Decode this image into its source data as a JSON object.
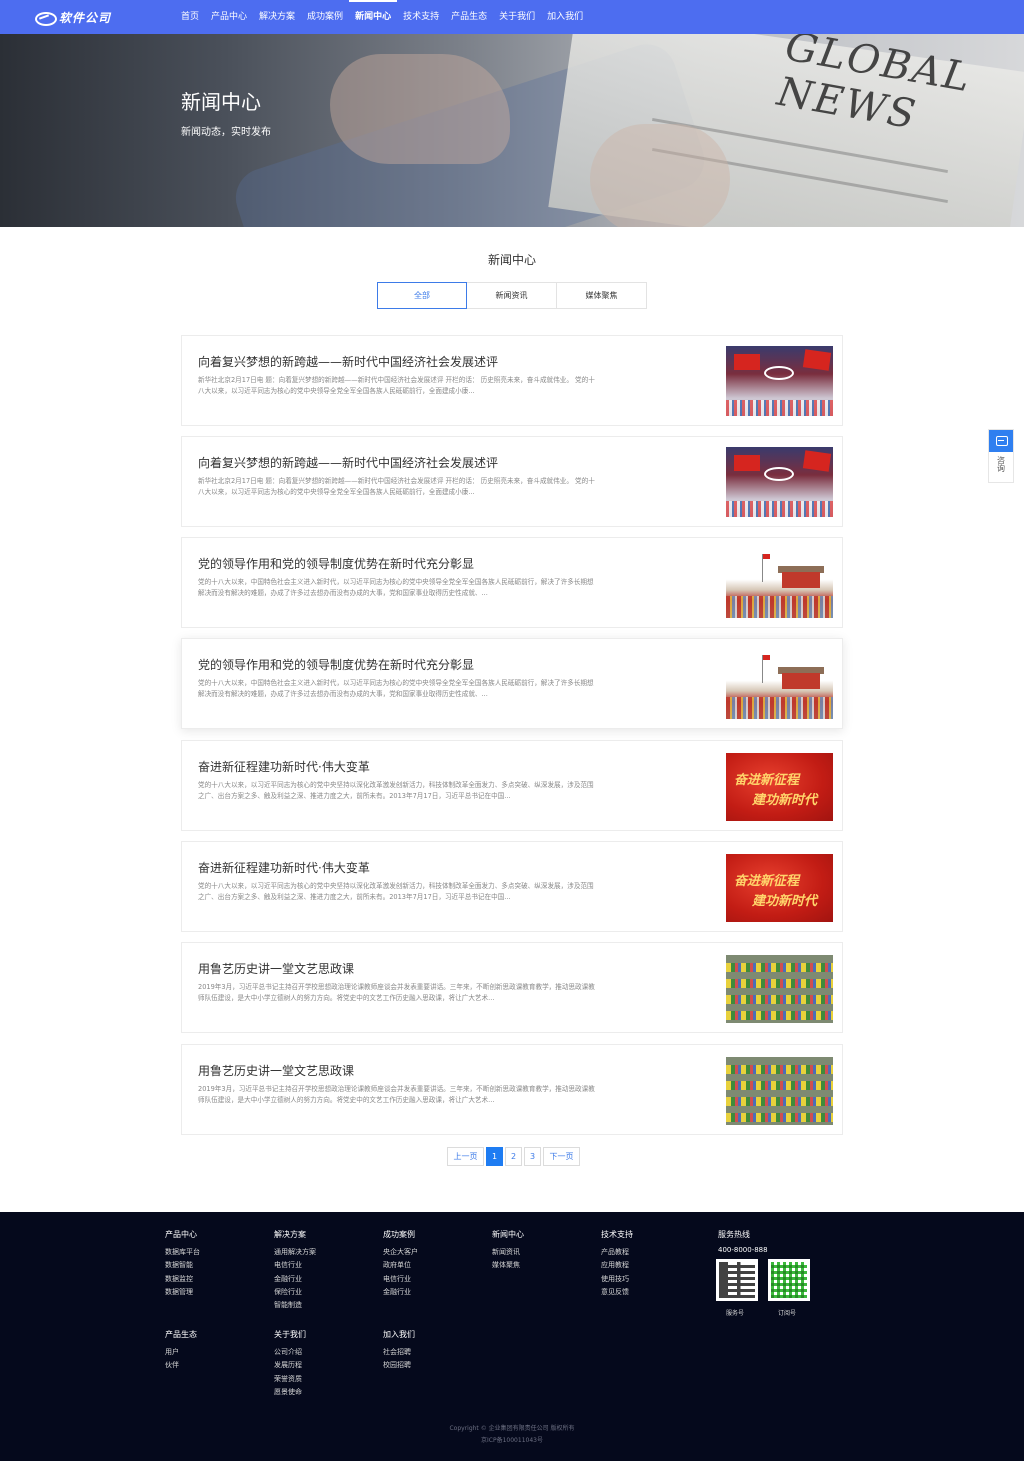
{
  "header": {
    "logo_text": "软件公司",
    "nav": [
      {
        "label": "首页",
        "active": false
      },
      {
        "label": "产品中心",
        "active": false
      },
      {
        "label": "解决方案",
        "active": false
      },
      {
        "label": "成功案例",
        "active": false
      },
      {
        "label": "新闻中心",
        "active": true
      },
      {
        "label": "技术支持",
        "active": false
      },
      {
        "label": "产品生态",
        "active": false
      },
      {
        "label": "关于我们",
        "active": false
      },
      {
        "label": "加入我们",
        "active": false
      }
    ]
  },
  "banner": {
    "title": "新闻中心",
    "subtitle": "新闻动态，实时发布",
    "image_text": "GLOBAL NEWS"
  },
  "section": {
    "title": "新闻中心",
    "tabs": [
      {
        "label": "全部",
        "active": true
      },
      {
        "label": "新闻资讯",
        "active": false
      },
      {
        "label": "媒体聚焦",
        "active": false
      }
    ]
  },
  "news": [
    {
      "title": "向着复兴梦想的新跨越——新时代中国经济社会发展述评",
      "desc": "新华社北京2月17日电 题：向着复兴梦想的新跨越——新时代中国经济社会发展述评 开栏的话： 历史照亮未来，奋斗成就伟业。 党的十八大以来，以习近平同志为核心的党中央领导全党全军全国各族人民砥砺前行，全面建成小康...",
      "thumb": "olympic"
    },
    {
      "title": "向着复兴梦想的新跨越——新时代中国经济社会发展述评",
      "desc": "新华社北京2月17日电 题：向着复兴梦想的新跨越——新时代中国经济社会发展述评 开栏的话： 历史照亮未来，奋斗成就伟业。 党的十八大以来，以习近平同志为核心的党中央领导全党全军全国各族人民砥砺前行，全面建成小康...",
      "thumb": "olympic"
    },
    {
      "title": "党的领导作用和党的领导制度优势在新时代充分彰显",
      "desc": "党的十八大以来，中国特色社会主义进入新时代，以习近平同志为核心的党中央领导全党全军全国各族人民砥砺前行，解决了许多长期想解决而没有解决的难题，办成了许多过去想办而没有办成的大事，党和国家事业取得历史性成就、...",
      "thumb": "square"
    },
    {
      "title": "党的领导作用和党的领导制度优势在新时代充分彰显",
      "desc": "党的十八大以来，中国特色社会主义进入新时代，以习近平同志为核心的党中央领导全党全军全国各族人民砥砺前行，解决了许多长期想解决而没有解决的难题，办成了许多过去想办而没有办成的大事，党和国家事业取得历史性成就、...",
      "thumb": "square"
    },
    {
      "title": "奋进新征程建功新时代·伟大变革",
      "desc": "党的十八大以来，以习近平同志为核心的党中央坚持以深化改革激发创新活力，科技体制改革全面发力、多点突破、纵深发展，涉及范围之广、出台方案之多、触及利益之深、推进力度之大，前所未有。2013年7月17日，习近平总书记在中国...",
      "thumb": "red",
      "thumb_line1": "奋进新征程",
      "thumb_line2": "建功新时代"
    },
    {
      "title": "奋进新征程建功新时代·伟大变革",
      "desc": "党的十八大以来，以习近平同志为核心的党中央坚持以深化改革激发创新活力，科技体制改革全面发力、多点突破、纵深发展，涉及范围之广、出台方案之多、触及利益之深、推进力度之大，前所未有。2013年7月17日，习近平总书记在中国...",
      "thumb": "red",
      "thumb_line1": "奋进新征程",
      "thumb_line2": "建功新时代"
    },
    {
      "title": "用鲁艺历史讲一堂文艺思政课",
      "desc": "2019年3月，习近平总书记主持召开学校思想政治理论课教师座谈会并发表重要讲话。三年来，不断创新思政课教育教学，推动思政课教师队伍建设，是大中小学立德树人的努力方向。将党史中的文艺工作历史融入思政课，将让广大艺术...",
      "thumb": "aerial"
    },
    {
      "title": "用鲁艺历史讲一堂文艺思政课",
      "desc": "2019年3月，习近平总书记主持召开学校思想政治理论课教师座谈会并发表重要讲话。三年来，不断创新思政课教育教学，推动思政课教师队伍建设，是大中小学立德树人的努力方向。将党史中的文艺工作历史融入思政课，将让广大艺术...",
      "thumb": "aerial"
    }
  ],
  "pagination": {
    "prev": "上一页",
    "pages": [
      "1",
      "2",
      "3"
    ],
    "current": "1",
    "next": "下一页"
  },
  "float_widget": {
    "label": "咨询",
    "icon": "chat-icon"
  },
  "footer": {
    "columns_row1": [
      {
        "heading": "产品中心",
        "items": [
          "数据库平台",
          "数据智能",
          "数据监控",
          "数据管理"
        ]
      },
      {
        "heading": "解决方案",
        "items": [
          "通用解决方案",
          "电信行业",
          "金融行业",
          "保险行业",
          "智能制造"
        ]
      },
      {
        "heading": "成功案例",
        "items": [
          "央企大客户",
          "政府单位",
          "电信行业",
          "金融行业"
        ]
      },
      {
        "heading": "新闻中心",
        "items": [
          "新闻资讯",
          "媒体聚焦"
        ]
      },
      {
        "heading": "技术支持",
        "items": [
          "产品教程",
          "应用教程",
          "使用技巧",
          "意见反馈"
        ]
      }
    ],
    "columns_row2": [
      {
        "heading": "产品生态",
        "items": [
          "用户",
          "伙伴"
        ]
      },
      {
        "heading": "关于我们",
        "items": [
          "公司介绍",
          "发展历程",
          "荣誉资质",
          "愿景使命"
        ]
      },
      {
        "heading": "加入我们",
        "items": [
          "社会招聘",
          "校园招聘"
        ]
      }
    ],
    "hotline_title": "服务热线",
    "hotline_number": "400-8000-888",
    "qr_labels": [
      "服务号",
      "订阅号"
    ],
    "copyright_line1": "Copyright © 企业集团有限责任公司 版权所有",
    "copyright_line2": "京ICP备100011043号"
  },
  "colors": {
    "header_bg": "#4d6df0",
    "accent": "#3d7be8",
    "footer_bg": "#05091c"
  }
}
